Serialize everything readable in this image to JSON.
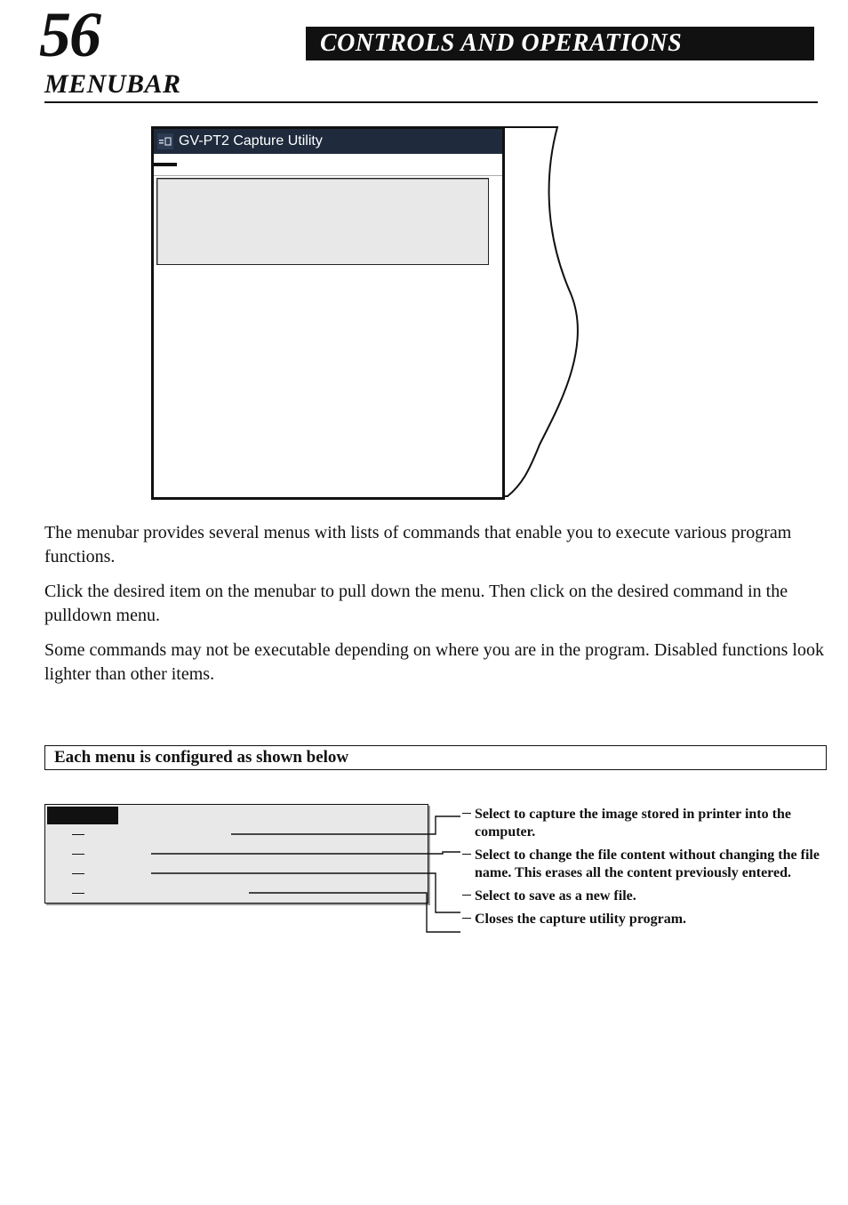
{
  "page_number": "56",
  "banner": "CONTROLS AND OPERATIONS",
  "section": "MENUBAR",
  "window_title": "GV-PT2 Capture Utility",
  "menubar_items": [
    "",
    "",
    ""
  ],
  "dropdown_items": [
    "",
    "",
    "",
    ""
  ],
  "paragraphs": [
    "The menubar provides several menus with lists of commands that enable you to execute various program functions.",
    "Click the desired item on the menubar to pull down the menu. Then click on the desired command in the pulldown menu.",
    "Some commands may not be executable depending on where you are in the program.  Disabled functions look lighter than other items."
  ],
  "config_label": "Each menu is configured as shown below",
  "callouts": [
    "Select to capture the image stored in printer into the computer.",
    "Select to change the file content without changing the file name. This erases all the content previously entered.",
    "Select to save as a new file.",
    "Closes the capture utility program."
  ]
}
